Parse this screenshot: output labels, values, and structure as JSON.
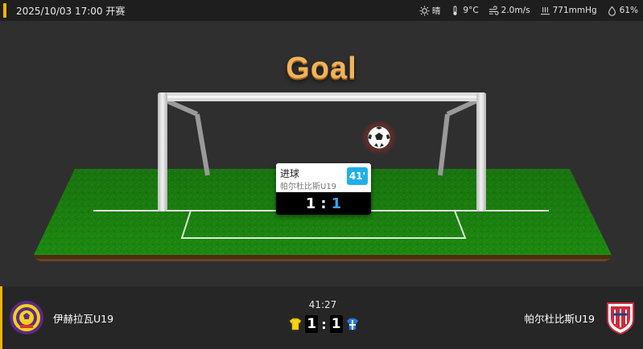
{
  "header": {
    "kickoff": "2025/10/03 17:00 开赛",
    "weather": [
      {
        "icon": "sun-icon",
        "text": "晴"
      },
      {
        "icon": "thermometer-icon",
        "text": "9°C"
      },
      {
        "icon": "wind-icon",
        "text": "2.0m/s"
      },
      {
        "icon": "pressure-icon",
        "text": "771mmHg"
      },
      {
        "icon": "humidity-icon",
        "text": "61%"
      }
    ]
  },
  "animation": {
    "title": "Goal",
    "event": {
      "type": "进球",
      "team": "帕尔杜比斯U19",
      "minute": "41'",
      "home_score": "1",
      "separator": ":",
      "away_score": "1"
    }
  },
  "scoreboard": {
    "home_team": "伊赫拉瓦U19",
    "away_team": "帕尔杜比斯U19",
    "clock": "41:27",
    "home_score": "1",
    "separator": ":",
    "away_score": "1"
  },
  "colors": {
    "accent": "#f5b400",
    "minute_badge": "#1eb0ea",
    "away_score": "#3aa3f0",
    "pitch": "#1f8a12",
    "title": "#f0b35a"
  }
}
